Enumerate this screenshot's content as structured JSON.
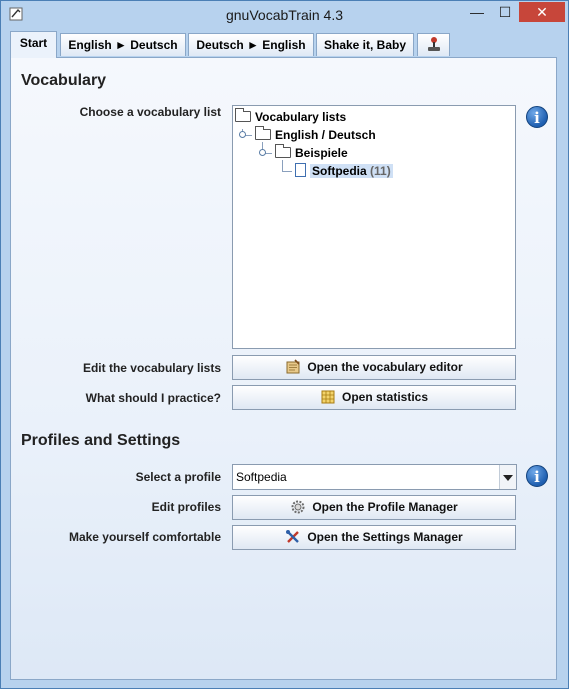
{
  "window": {
    "title": "gnuVocabTrain 4.3",
    "controls": {
      "minimize": "—",
      "maximize": "☐",
      "close": "✕"
    }
  },
  "tabs": [
    {
      "label": "Start",
      "active": true
    },
    {
      "label": "English ► Deutsch"
    },
    {
      "label": "Deutsch ► English"
    },
    {
      "label": "Shake it, Baby"
    },
    {
      "label": "",
      "icon": "joystick-icon"
    }
  ],
  "vocabulary": {
    "heading": "Vocabulary",
    "choose_label": "Choose a vocabulary list",
    "tree": {
      "root": "Vocabulary lists",
      "child": "English / Deutsch",
      "grandchild": "Beispiele",
      "leaf": {
        "name": "Softpedia",
        "count": "(11)"
      }
    },
    "edit_label": "Edit the vocabulary lists",
    "edit_button": "Open the vocabulary editor",
    "practice_label": "What should I practice?",
    "practice_button": "Open statistics"
  },
  "profiles": {
    "heading": "Profiles and Settings",
    "select_label": "Select a profile",
    "selected_profile": "Softpedia",
    "edit_label": "Edit profiles",
    "edit_button": "Open the Profile Manager",
    "comfort_label": "Make yourself comfortable",
    "settings_button": "Open the Settings Manager"
  },
  "info_glyph": "i",
  "icons": {
    "app": "app-icon",
    "tree_folder": "folder-icon",
    "tree_file": "file-icon",
    "editor": "book-icon",
    "statistics": "calendar-icon",
    "profile_manager": "gear-icon",
    "settings_manager": "tools-icon",
    "info": "info-icon"
  },
  "colors": {
    "window_frame": "#b7d2ee",
    "close_button": "#c7463a",
    "panel": "#eaf1fa",
    "info_blue": "#1f5fb0",
    "selection": "#cfe0f5"
  }
}
